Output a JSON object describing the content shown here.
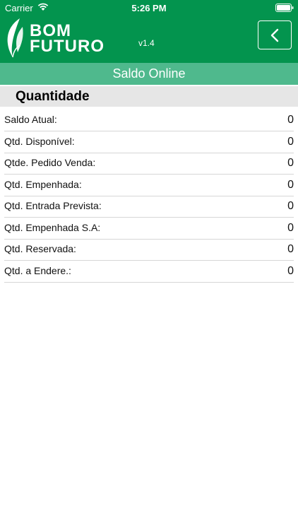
{
  "status_bar": {
    "carrier": "Carrier",
    "time": "5:26 PM"
  },
  "header": {
    "logo_line1": "BOM",
    "logo_line2": "FUTURO",
    "version": "v1.4",
    "back_icon": "chevron-left-icon",
    "bg_color": "#03944e"
  },
  "subheader": {
    "title": "Saldo Online",
    "bg_color": "#4fb98d"
  },
  "section": {
    "title": "Quantidade"
  },
  "rows": [
    {
      "label": "Saldo Atual:",
      "value": "0"
    },
    {
      "label": "Qtd. Disponível:",
      "value": "0"
    },
    {
      "label": "Qtde. Pedido Venda:",
      "value": "0"
    },
    {
      "label": "Qtd. Empenhada:",
      "value": "0"
    },
    {
      "label": "Qtd. Entrada Prevista:",
      "value": "0"
    },
    {
      "label": "Qtd. Empenhada S.A:",
      "value": "0"
    },
    {
      "label": "Qtd. Reservada:",
      "value": "0"
    },
    {
      "label": "Qtd. a Endere.:",
      "value": "0"
    }
  ]
}
